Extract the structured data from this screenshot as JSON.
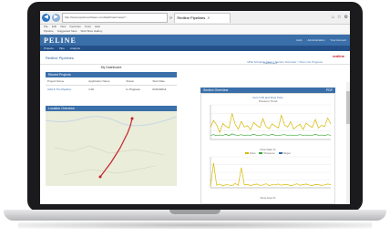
{
  "browser": {
    "url": "http://www.pipelinesoftware.com/dashboard.aspx?...",
    "tab_title": "Redline Pipelines",
    "menu": [
      "File",
      "Edit",
      "View",
      "Favorites",
      "Tools",
      "Help"
    ],
    "favorites": [
      "Pipeline",
      "Suggested Sites",
      "Web Slice Gallery"
    ]
  },
  "app": {
    "logo": "PELINE",
    "header_links": [
      "Help",
      "Administration",
      "Your Account"
    ],
    "nav": [
      "Projects",
      "Pipe",
      "Analysis"
    ],
    "page_title": "Redline Pipelines",
    "client_logo": "redline",
    "breadcrumb": "MFE Schedule View > Section Overview > Pipe Line Progress",
    "welcome": "Dashboard"
  },
  "left": {
    "dashboard_label": "My Dashboard",
    "recent_projects": {
      "title": "Recent Projects",
      "columns": [
        "Project Name",
        "Application Name",
        "Status",
        "Start Date"
      ],
      "rows": [
        [
          "CZA & Trio Pipeline",
          "1.00",
          "In Progress",
          "01/01/2014"
        ]
      ]
    },
    "location_title": "Location Overview"
  },
  "right": {
    "section_title": "Section Overview",
    "pdf_label": "PDF",
    "chart_top_label": "Item 1.00 and Flow Tube",
    "chart1_title": "Pressure Trend",
    "chart1_xlabel": "Flow Rate %",
    "chart2_title": "Flow Area %",
    "legend": [
      "Flow",
      "Pressure",
      "Target"
    ]
  },
  "chart_data": [
    {
      "type": "line",
      "title": "Pressure Trend",
      "xlabel": "Flow Rate %",
      "x": [
        0,
        1,
        2,
        3,
        4,
        5,
        6,
        7,
        8,
        9,
        10,
        11,
        12,
        13,
        14,
        15,
        16,
        17,
        18,
        19,
        20,
        21,
        22,
        23,
        24,
        25,
        26,
        27,
        28,
        29,
        30,
        31,
        32,
        33,
        34,
        35,
        36,
        37,
        38,
        39
      ],
      "series": [
        {
          "name": "Flow",
          "color": "#d6b800",
          "values": [
            35,
            55,
            42,
            20,
            46,
            38,
            33,
            75,
            44,
            30,
            52,
            36,
            40,
            28,
            49,
            41,
            34,
            60,
            37,
            31,
            45,
            39,
            33,
            70,
            42,
            36,
            51,
            30,
            38,
            44,
            29,
            47,
            40,
            35,
            58,
            33,
            41,
            37,
            62,
            45
          ]
        },
        {
          "name": "Pressure",
          "color": "#3aa835",
          "values": [
            12,
            14,
            11,
            13,
            12,
            15,
            11,
            16,
            13,
            12,
            14,
            11,
            13,
            12,
            15,
            12,
            11,
            14,
            13,
            12,
            15,
            12,
            11,
            13,
            14,
            12,
            13,
            11,
            12,
            14,
            12,
            13,
            11,
            12,
            15,
            12,
            13,
            11,
            14,
            12
          ]
        }
      ],
      "ylim": [
        0,
        100
      ]
    },
    {
      "type": "line",
      "title": "Flow Area %",
      "x": [
        0,
        1,
        2,
        3,
        4,
        5,
        6,
        7,
        8,
        9,
        10,
        11,
        12,
        13,
        14,
        15,
        16,
        17,
        18,
        19,
        20,
        21,
        22,
        23,
        24,
        25,
        26,
        27,
        28,
        29,
        30,
        31,
        32,
        33,
        34,
        35,
        36,
        37,
        38,
        39
      ],
      "series": [
        {
          "name": "Flow",
          "color": "#d6b800",
          "values": [
            5,
            80,
            8,
            12,
            6,
            10,
            9,
            7,
            14,
            8,
            65,
            9,
            11,
            7,
            10,
            12,
            8,
            9,
            13,
            7,
            10,
            9,
            12,
            8,
            11,
            10,
            7,
            9,
            13,
            8,
            10,
            12,
            9,
            7,
            11,
            10,
            8,
            9,
            12,
            10
          ]
        }
      ],
      "ylim": [
        0,
        100
      ]
    }
  ],
  "colors": {
    "header": "#3a6fa9",
    "accent": "#2c6cb0",
    "route": "#c8202c"
  }
}
